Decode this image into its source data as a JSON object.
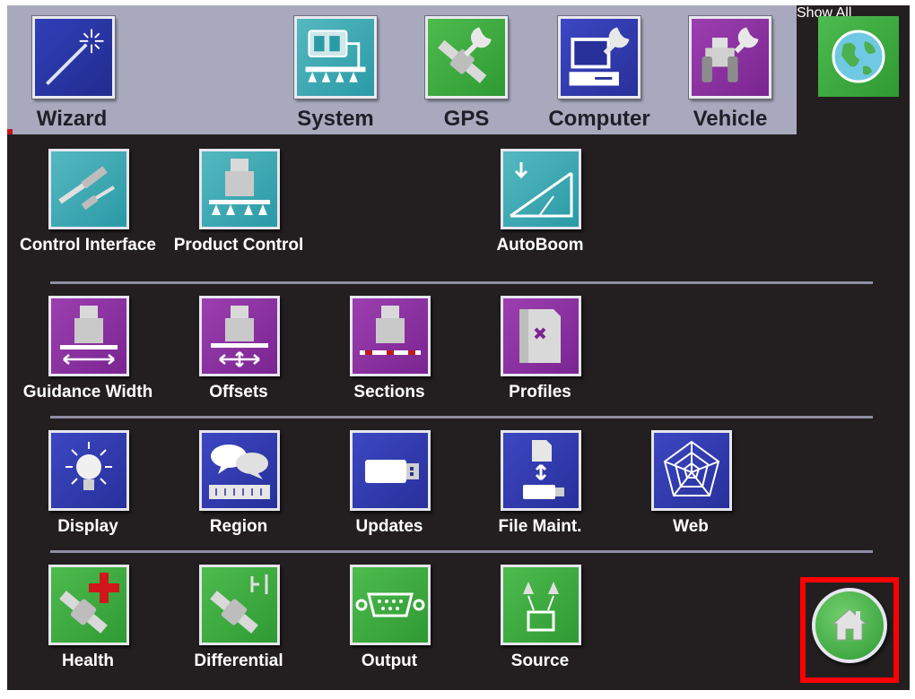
{
  "toolbar": {
    "wizard": "Wizard",
    "system": "System",
    "gps": "GPS",
    "computer": "Computer",
    "vehicle": "Vehicle",
    "show_all": "Show All"
  },
  "rows": {
    "row1": {
      "control_interface": "Control Interface",
      "product_control": "Product Control",
      "autoboom": "AutoBoom"
    },
    "row2": {
      "guidance_width": "Guidance Width",
      "offsets": "Offsets",
      "sections": "Sections",
      "profiles": "Profiles"
    },
    "row3": {
      "display": "Display",
      "region": "Region",
      "updates": "Updates",
      "file_maint": "File Maint.",
      "web": "Web"
    },
    "row4": {
      "health": "Health",
      "differential": "Differential",
      "output": "Output",
      "source": "Source"
    }
  },
  "icons": {
    "wizard": "magic-wand-icon",
    "system": "sprayer-icon",
    "gps": "satellite-wrench-icon",
    "computer": "computer-wrench-icon",
    "vehicle": "tractor-wrench-icon",
    "show_all": "globe-icon",
    "home": "home-icon"
  },
  "colors": {
    "system_category": "#2a9aa6",
    "gps_category": "#2f9a33",
    "computer_category": "#28309a",
    "vehicle_category": "#7a2591",
    "highlight": "#ff0000"
  }
}
